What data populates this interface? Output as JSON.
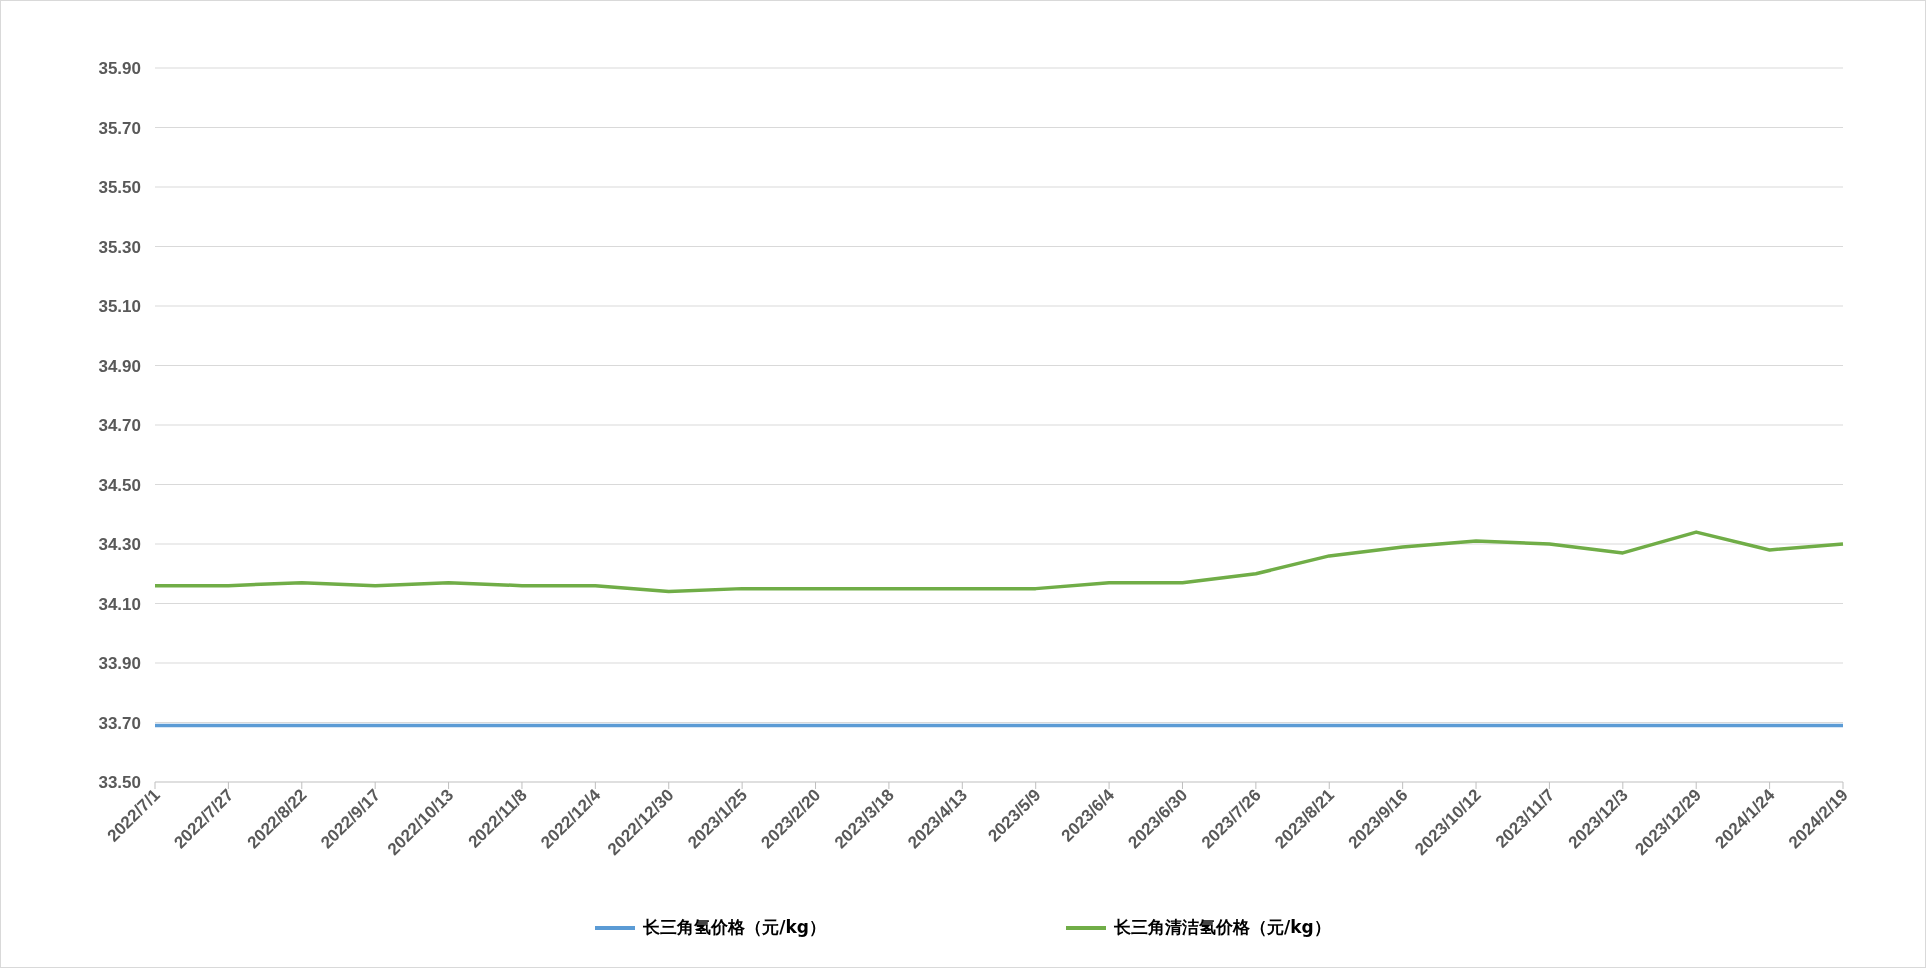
{
  "chart_data": {
    "type": "line",
    "grid": true,
    "categories": [
      "2022/7/1",
      "2022/7/27",
      "2022/8/22",
      "2022/9/17",
      "2022/10/13",
      "2022/11/8",
      "2022/12/4",
      "2022/12/30",
      "2023/1/25",
      "2023/2/20",
      "2023/3/18",
      "2023/4/13",
      "2023/5/9",
      "2023/6/4",
      "2023/6/30",
      "2023/7/26",
      "2023/8/21",
      "2023/9/16",
      "2023/10/12",
      "2023/11/7",
      "2023/12/3",
      "2023/12/29",
      "2024/1/24",
      "2024/2/19"
    ],
    "ylim": [
      33.5,
      35.9
    ],
    "yticks": [
      {
        "value": 33.5,
        "label": "33.50"
      },
      {
        "value": 33.7,
        "label": "33.70"
      },
      {
        "value": 33.9,
        "label": "33.90"
      },
      {
        "value": 34.1,
        "label": "34.10"
      },
      {
        "value": 34.3,
        "label": "34.30"
      },
      {
        "value": 34.5,
        "label": "34.50"
      },
      {
        "value": 34.7,
        "label": "34.70"
      },
      {
        "value": 34.9,
        "label": "34.90"
      },
      {
        "value": 35.1,
        "label": "35.10"
      },
      {
        "value": 35.3,
        "label": "35.30"
      },
      {
        "value": 35.5,
        "label": "35.50"
      },
      {
        "value": 35.7,
        "label": "35.70"
      },
      {
        "value": 35.9,
        "label": "35.90"
      }
    ],
    "series": [
      {
        "name": "长三角氢价格（元/kg）",
        "color": "#5b9bd5",
        "values": [
          33.69,
          33.69,
          33.69,
          33.69,
          33.69,
          33.69,
          33.69,
          33.69,
          33.69,
          33.69,
          33.69,
          33.69,
          33.69,
          33.69,
          33.69,
          33.69,
          33.69,
          33.69,
          33.69,
          33.69,
          33.69,
          33.69,
          33.69,
          33.69
        ]
      },
      {
        "name": "长三角清洁氢价格（元/kg）",
        "color": "#70ad47",
        "values": [
          34.16,
          34.16,
          34.17,
          34.16,
          34.17,
          34.16,
          34.16,
          34.14,
          34.15,
          34.15,
          34.15,
          34.15,
          34.15,
          34.17,
          34.17,
          34.2,
          34.26,
          34.29,
          34.31,
          34.3,
          34.27,
          34.34,
          34.28,
          34.3
        ]
      }
    ]
  }
}
